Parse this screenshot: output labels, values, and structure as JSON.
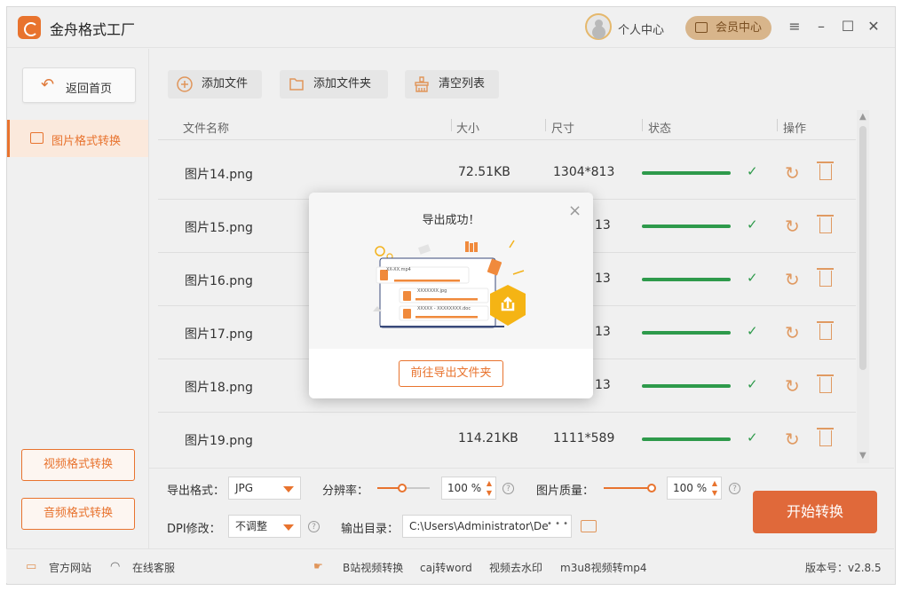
{
  "app": {
    "title": "金舟格式工厂"
  },
  "header": {
    "user_center": "个人中心",
    "vip_center": "会员中心",
    "menu_icon": "≡",
    "min_icon": "–",
    "max_icon": "☐",
    "close_icon": "✕"
  },
  "sidebar": {
    "back_home": "返回首页",
    "items": [
      {
        "label": "图片格式转换",
        "active": true
      }
    ],
    "video_btn": "视频格式转换",
    "audio_btn": "音频格式转换"
  },
  "toolbar": {
    "add_file": "添加文件",
    "add_folder": "添加文件夹",
    "clear_list": "清空列表"
  },
  "table": {
    "columns": [
      "文件名称",
      "大小",
      "尺寸",
      "状态",
      "操作"
    ],
    "rows": [
      {
        "name": "图片14.png",
        "size": "72.51KB",
        "dims": "1304*813"
      },
      {
        "name": "图片15.png",
        "size": "",
        "dims": "13"
      },
      {
        "name": "图片16.png",
        "size": "",
        "dims": "13"
      },
      {
        "name": "图片17.png",
        "size": "",
        "dims": "13"
      },
      {
        "name": "图片18.png",
        "size": "",
        "dims": "13"
      },
      {
        "name": "图片19.png",
        "size": "114.21KB",
        "dims": "1111*589"
      }
    ]
  },
  "settings": {
    "format_label": "导出格式：",
    "format_value": "JPG",
    "resolution_label": "分辨率：",
    "resolution_value": "100 %",
    "quality_label": "图片质量：",
    "quality_value": "100 %",
    "dpi_label": "DPI修改：",
    "dpi_value": "不调整",
    "output_label": "输出目录：",
    "output_path": "C:\\Users\\Administrator\\De",
    "output_more": "• • •",
    "start": "开始转换"
  },
  "footer": {
    "website": "官方网站",
    "service": "在线客服",
    "links": [
      "B站视频转换",
      "caj转word",
      "视频去水印",
      "m3u8视频转mp4"
    ],
    "version": "版本号：v2.8.5"
  },
  "modal": {
    "title": "导出成功！",
    "goto_folder": "前往导出文件夹",
    "illus_line1": "XX-XX.mp4",
    "illus_line2": "XXXXXXX.jpg",
    "illus_line3": "XXXXX - XXXXXXXX.doc"
  },
  "colors": {
    "accent": "#e8732e",
    "success": "#2e9a4b",
    "vip": "#d8b58b"
  }
}
